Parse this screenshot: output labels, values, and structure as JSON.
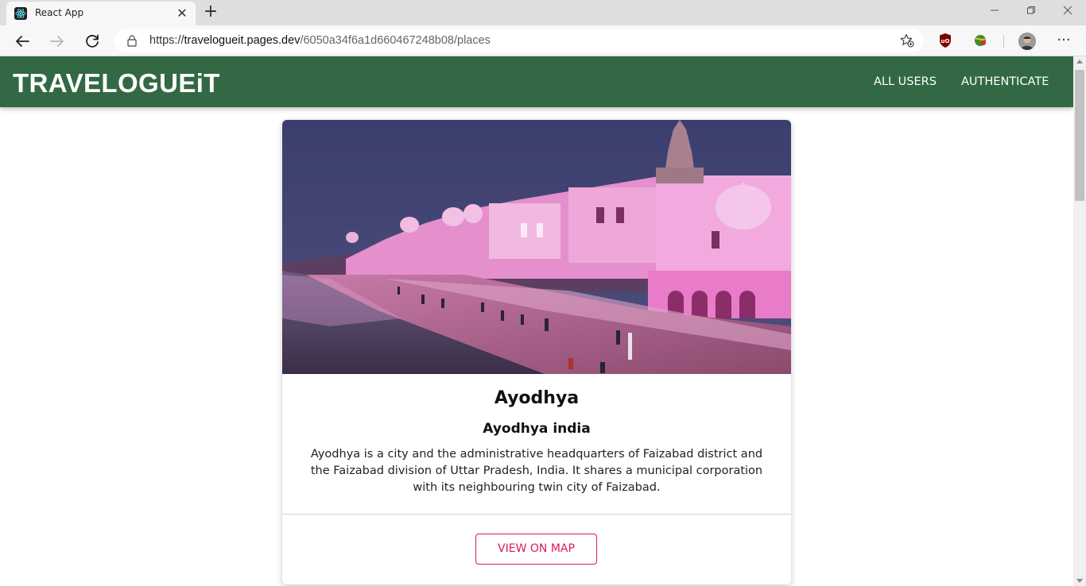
{
  "browser": {
    "tab_title": "React App",
    "url_scheme": "https://",
    "url_host": "travelogueit.pages.dev",
    "url_path": "/6050a34f6a1d660467248b08/places",
    "new_tab_label": "+",
    "close_label": "✕",
    "menu_label": "···"
  },
  "app": {
    "brand": "TRAVELOGUEiT",
    "nav": [
      "ALL USERS",
      "AUTHENTICATE"
    ],
    "primary_color": "#326944",
    "accent_color": "#d81b5f"
  },
  "place": {
    "title": "Ayodhya",
    "address": "Ayodhya india",
    "description": "Ayodhya is a city and the administrative headquarters of Faizabad district and the Faizabad division of Uttar Pradesh, India. It shares a municipal corporation with its neighbouring twin city of Faizabad.",
    "view_on_map_label": "VIEW ON MAP"
  }
}
